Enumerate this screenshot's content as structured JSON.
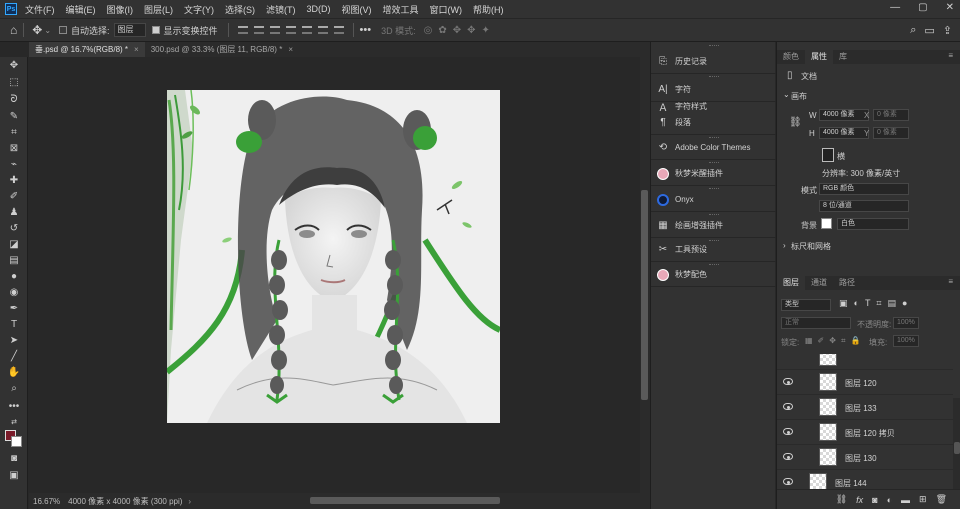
{
  "app": {
    "logo": "Ps"
  },
  "menu": [
    "文件(F)",
    "编辑(E)",
    "图像(I)",
    "图层(L)",
    "文字(Y)",
    "选择(S)",
    "滤镜(T)",
    "3D(D)",
    "视图(V)",
    "增效工具",
    "窗口(W)",
    "帮助(H)"
  ],
  "options": {
    "auto_select_label": "自动选择:",
    "auto_select_value": "图层",
    "show_transform_label": "显示变换控件",
    "mode_3d_label": "3D 模式:"
  },
  "tabs": [
    {
      "label": "垂.psd @ 16.7%(RGB/8) *",
      "active": true
    },
    {
      "label": "300.psd @ 33.3% (图层 11, RGB/8) *",
      "active": false
    }
  ],
  "status": {
    "zoom": "16.67%",
    "doc_size": "4000 像素 x 4000 像素 (300 ppi)"
  },
  "collapsed_panels": [
    {
      "label": "历史记录",
      "icon": "history-icon"
    },
    {
      "label": "字符",
      "icon": "character-icon"
    },
    {
      "label": "字符样式",
      "icon": "character-styles-icon"
    },
    {
      "label": "段落",
      "icon": "paragraph-icon"
    },
    {
      "label": "Adobe Color Themes",
      "icon": "color-themes-icon"
    },
    {
      "label": "秋梦米醒插件",
      "icon": "plugin-avatar-icon"
    },
    {
      "label": "Onyx",
      "icon": "onyx-icon"
    },
    {
      "label": "绘画增强插件",
      "icon": "brush-plugin-icon"
    },
    {
      "label": "工具预设",
      "icon": "tool-presets-icon"
    },
    {
      "label": "秋梦配色",
      "icon": "color-plugin-avatar-icon"
    }
  ],
  "properties": {
    "tabs": [
      "颜色",
      "属性",
      "库"
    ],
    "active_tab": "属性",
    "doc_label": "文档",
    "canvas_section": "画布",
    "w_label": "W",
    "w_value": "4000 像素",
    "h_label": "H",
    "h_value": "4000 像素",
    "x_label": "X",
    "x_placeholder": "0 像素",
    "y_label": "Y",
    "y_placeholder": "0 像素",
    "orientation_label": "横",
    "resolution": "分辨率: 300 像素/英寸",
    "mode_label": "模式",
    "mode_value": "RGB 颜色",
    "depth_value": "8 位/通道",
    "bg_label": "背景",
    "bg_value": "白色",
    "rulers_section": "标尺和网格"
  },
  "layers_panel": {
    "tabs": [
      "图层",
      "通道",
      "路径"
    ],
    "active_tab": "图层",
    "filter_value": "类型",
    "blend_mode": "正常",
    "opacity_label": "不透明度:",
    "opacity_value": "100%",
    "lock_label": "锁定:",
    "fill_label": "填充:",
    "fill_value": "100%",
    "layers": [
      {
        "name": "图层 120",
        "indent": true
      },
      {
        "name": "图层 133",
        "indent": true
      },
      {
        "name": "图层 120 拷贝",
        "indent": true
      },
      {
        "name": "图层 130",
        "indent": true
      },
      {
        "name": "图层 144",
        "indent": false
      }
    ],
    "footer_icons": [
      "link-icon",
      "fx-icon",
      "mask-icon",
      "adjustment-icon",
      "group-icon",
      "new-layer-icon",
      "delete-icon"
    ]
  },
  "colors": {
    "foreground": "#7a1b2a",
    "background": "#ffffff",
    "accent": "#31a8ff"
  }
}
